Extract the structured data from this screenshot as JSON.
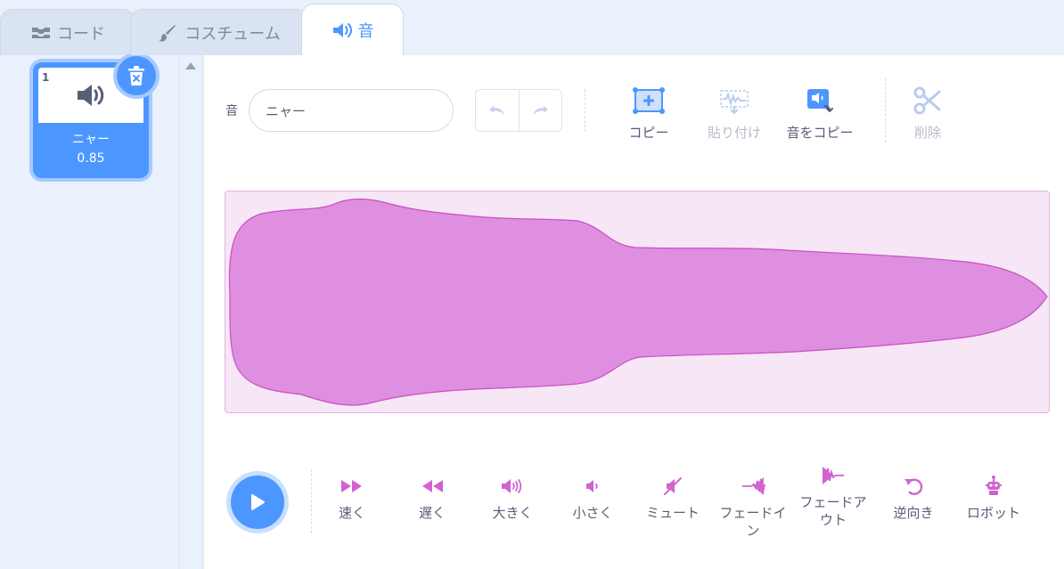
{
  "tabs": [
    {
      "label": "コード",
      "icon": "code-icon"
    },
    {
      "label": "コスチューム",
      "icon": "brush-icon"
    },
    {
      "label": "音",
      "icon": "speaker-icon"
    }
  ],
  "sound_list": {
    "items": [
      {
        "number": "1",
        "name": "ニャー",
        "duration": "0.85",
        "icon": "speaker-icon"
      }
    ]
  },
  "editor": {
    "name_label": "音",
    "name_value": "ニャー",
    "tools": [
      {
        "label": "コピー",
        "icon": "copy-icon",
        "enabled": true
      },
      {
        "label": "貼り付け",
        "icon": "paste-icon",
        "enabled": false
      },
      {
        "label": "音をコピー",
        "icon": "copy-to-new-icon",
        "enabled": true
      },
      {
        "label": "削除",
        "icon": "scissors-icon",
        "enabled": false
      }
    ],
    "effects": [
      {
        "label": "速く",
        "icon": "faster-icon"
      },
      {
        "label": "遅く",
        "icon": "slower-icon"
      },
      {
        "label": "大きく",
        "icon": "louder-icon"
      },
      {
        "label": "小さく",
        "icon": "softer-icon"
      },
      {
        "label": "ミュート",
        "icon": "mute-icon"
      },
      {
        "label": "フェードイン",
        "icon": "fade-in-icon"
      },
      {
        "label": "フェードアウト",
        "icon": "fade-out-icon"
      },
      {
        "label": "逆向き",
        "icon": "reverse-icon"
      },
      {
        "label": "ロボット",
        "icon": "robot-icon"
      }
    ]
  },
  "colors": {
    "accent": "#4c97ff",
    "waveform_fill": "#de8fdf",
    "waveform_stroke": "#c94fc7",
    "effect_icon": "#cf63cf"
  }
}
